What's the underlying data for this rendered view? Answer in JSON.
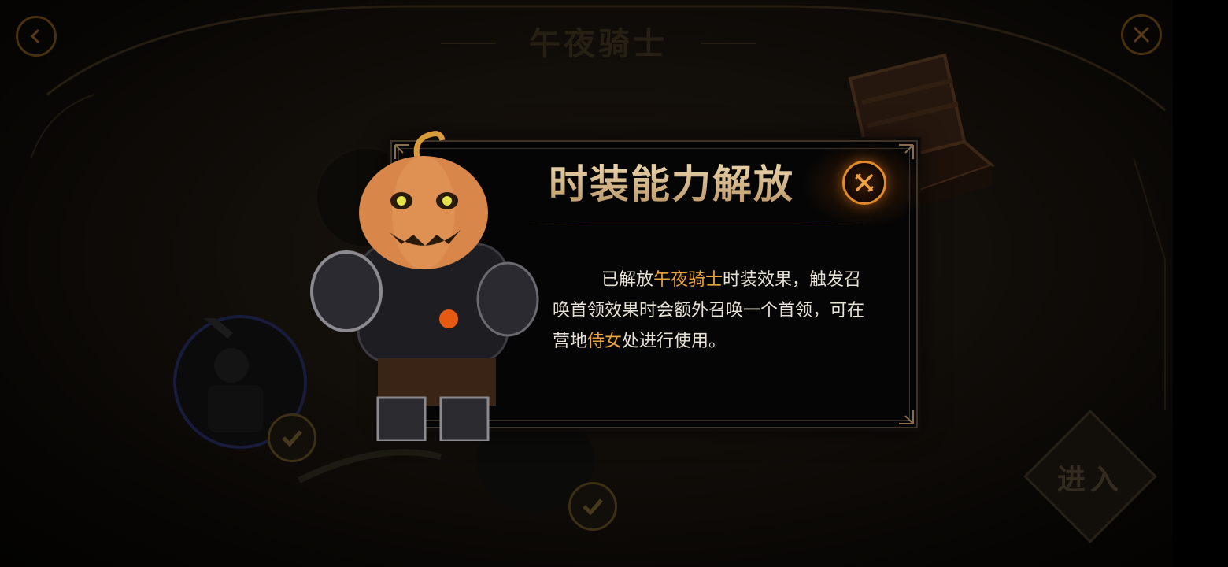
{
  "background": {
    "title": "午夜骑士",
    "enter_label": "进入"
  },
  "dialog": {
    "title": "时装能力解放",
    "description": [
      {
        "text": "已解放",
        "highlight": false
      },
      {
        "text": "午夜骑士",
        "highlight": true
      },
      {
        "text": "时装效果，触发召唤首领效果时会额外召唤一个首领，可在营地",
        "highlight": false
      },
      {
        "text": "侍女",
        "highlight": true
      },
      {
        "text": "处进行使用。",
        "highlight": false
      }
    ]
  },
  "colors": {
    "highlight": "#e8a33a",
    "close_ring": "#e3892a",
    "title_gold": "#d8bd92"
  },
  "icons": {
    "back": "chevron-left-icon",
    "bg_close": "crossed-swords-icon",
    "dialog_close": "crossed-swords-icon",
    "check": "checkmark-icon"
  }
}
